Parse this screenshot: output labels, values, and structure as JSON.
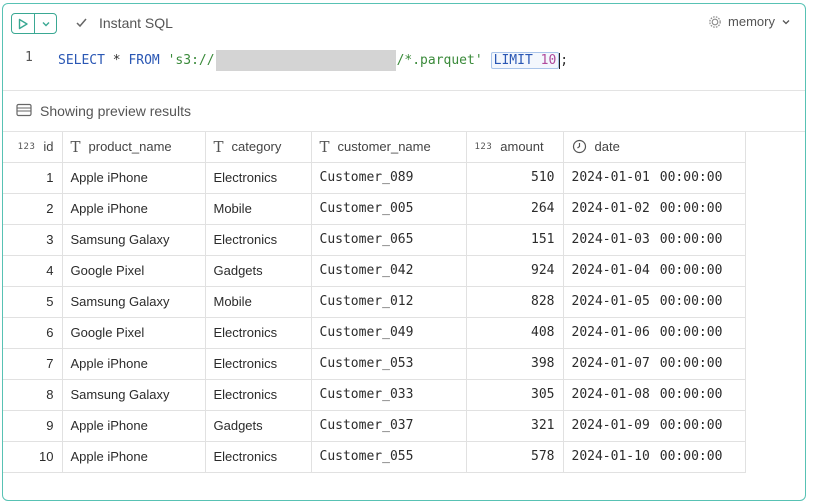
{
  "toolbar": {
    "mode_label": "Instant SQL",
    "database": "memory"
  },
  "editor": {
    "line_number": "1",
    "query_parts": {
      "select": "SELECT",
      "star": " * ",
      "from": "FROM",
      "str_start": " 's3://",
      "str_end": "/*.parquet'",
      "limit": "LIMIT",
      "limit_value": "10",
      "semicolon": ";"
    }
  },
  "status": {
    "text": "Showing preview results"
  },
  "table": {
    "columns": [
      {
        "name": "id",
        "type": "123"
      },
      {
        "name": "product_name",
        "type": "T"
      },
      {
        "name": "category",
        "type": "T"
      },
      {
        "name": "customer_name",
        "type": "T"
      },
      {
        "name": "amount",
        "type": "123"
      },
      {
        "name": "date",
        "type": "clock"
      }
    ],
    "rows": [
      [
        "1",
        "Apple iPhone",
        "Electronics",
        "Customer_089",
        "510",
        "2024-01-01",
        "00:00:00"
      ],
      [
        "2",
        "Apple iPhone",
        "Mobile",
        "Customer_005",
        "264",
        "2024-01-02",
        "00:00:00"
      ],
      [
        "3",
        "Samsung Galaxy",
        "Electronics",
        "Customer_065",
        "151",
        "2024-01-03",
        "00:00:00"
      ],
      [
        "4",
        "Google Pixel",
        "Gadgets",
        "Customer_042",
        "924",
        "2024-01-04",
        "00:00:00"
      ],
      [
        "5",
        "Samsung Galaxy",
        "Mobile",
        "Customer_012",
        "828",
        "2024-01-05",
        "00:00:00"
      ],
      [
        "6",
        "Google Pixel",
        "Electronics",
        "Customer_049",
        "408",
        "2024-01-06",
        "00:00:00"
      ],
      [
        "7",
        "Apple iPhone",
        "Electronics",
        "Customer_053",
        "398",
        "2024-01-07",
        "00:00:00"
      ],
      [
        "8",
        "Samsung Galaxy",
        "Electronics",
        "Customer_033",
        "305",
        "2024-01-08",
        "00:00:00"
      ],
      [
        "9",
        "Apple iPhone",
        "Gadgets",
        "Customer_037",
        "321",
        "2024-01-09",
        "00:00:00"
      ],
      [
        "10",
        "Apple iPhone",
        "Electronics",
        "Customer_055",
        "578",
        "2024-01-10",
        "00:00:00"
      ]
    ]
  },
  "icons": {
    "run": "play-icon",
    "dropdown": "chevron-down-icon",
    "instant": "check-icon",
    "database": "gear-icon",
    "preview": "table-icon",
    "date_type": "clock-icon"
  },
  "colors": {
    "accent": "#3aa893",
    "keyword": "#2a57b4",
    "string": "#3a8a3a",
    "number": "#b04a9c"
  }
}
